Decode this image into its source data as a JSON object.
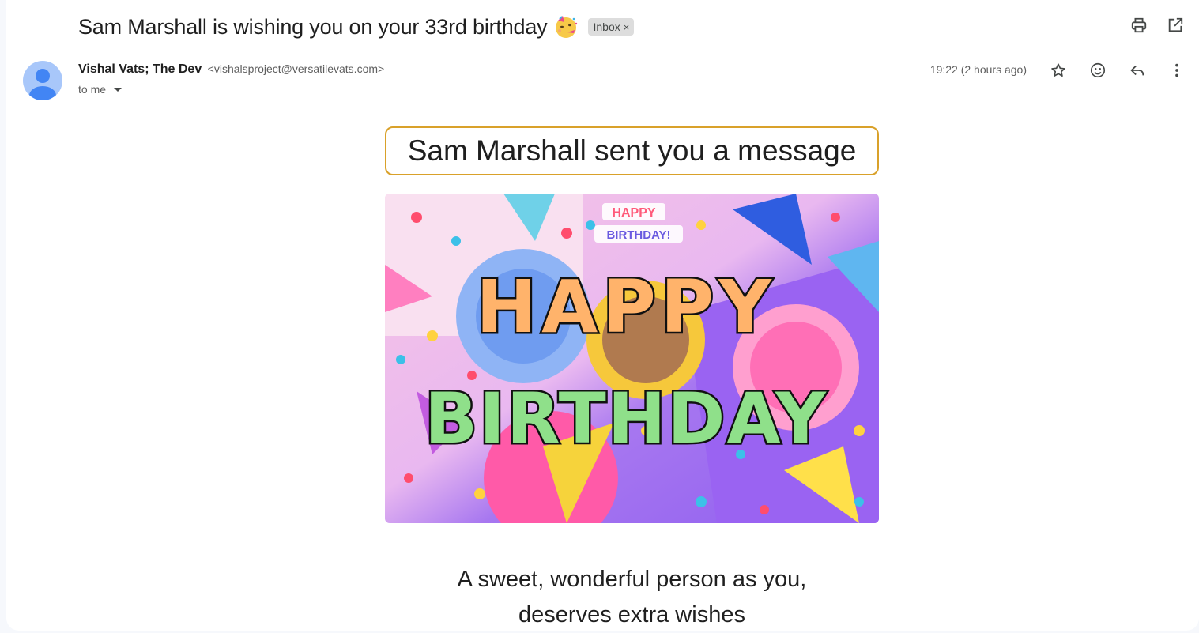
{
  "email": {
    "subject": "Sam Marshall is wishing you on your 33rd birthday",
    "subject_emoji": "partying-face-emoji",
    "label": "Inbox",
    "label_close": "×",
    "sender_name": "Vishal Vats; The Dev",
    "sender_email": "<vishalsproject@versatilevats.com>",
    "to_text": "to me",
    "timestamp": "19:22 (2 hours ago)"
  },
  "toolbar": {
    "icons": [
      "print-icon",
      "open-in-new-window-icon"
    ]
  },
  "message_actions": {
    "icons": [
      "star-icon",
      "emoji-reaction-icon",
      "reply-icon",
      "more-options-icon"
    ]
  },
  "body": {
    "header_text": "Sam Marshall sent you a message",
    "image_text_top_1": "HAPPY",
    "image_text_top_2": "BIRTHDAY!",
    "image_text_main_1": "HAPPY",
    "image_text_main_2": "BIRTHDAY",
    "wish_line_1": "A sweet, wonderful person as you,",
    "wish_line_2": "deserves extra wishes"
  },
  "colors": {
    "accent_border": "#d9a12a",
    "avatar_bg": "#a8c7fa",
    "avatar_fg": "#4285f4",
    "chip_bg": "#dddddd"
  }
}
